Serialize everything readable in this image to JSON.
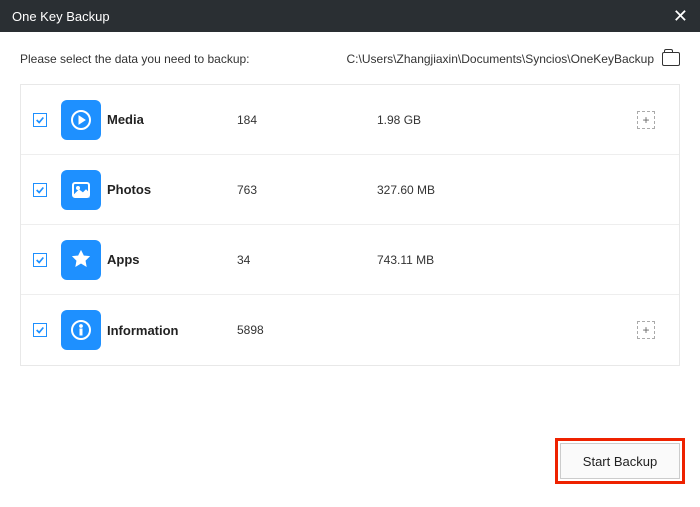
{
  "window": {
    "title": "One Key Backup",
    "close": "✕"
  },
  "header": {
    "prompt": "Please select the data you need to backup:",
    "path": "C:\\Users\\Zhangjiaxin\\Documents\\Syncios\\OneKeyBackup"
  },
  "rows": [
    {
      "icon": "media",
      "label": "Media",
      "count": "184",
      "size": "1.98 GB",
      "checked": true,
      "expandable": true
    },
    {
      "icon": "photos",
      "label": "Photos",
      "count": "763",
      "size": "327.60 MB",
      "checked": true,
      "expandable": false
    },
    {
      "icon": "apps",
      "label": "Apps",
      "count": "34",
      "size": "743.11 MB",
      "checked": true,
      "expandable": false
    },
    {
      "icon": "info",
      "label": "Information",
      "count": "5898",
      "size": "",
      "checked": true,
      "expandable": true
    }
  ],
  "footer": {
    "start": "Start Backup"
  },
  "icons": {
    "expand": "+"
  }
}
